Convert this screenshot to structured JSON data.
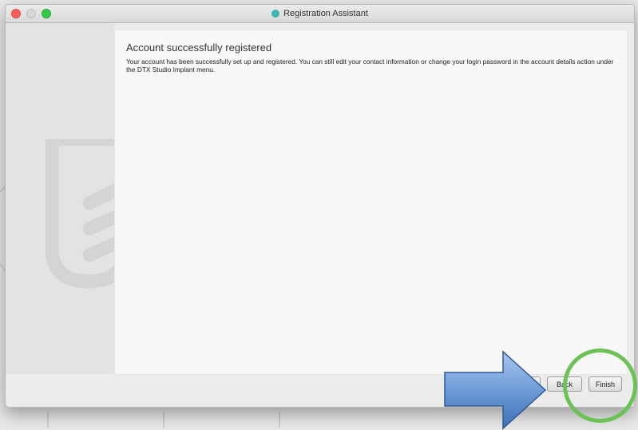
{
  "window": {
    "title": "Registration Assistant"
  },
  "content": {
    "heading": "Account successfully registered",
    "body": "Your account has been successfully set up and registered. You can still edit your contact information or change your login password in the account details action under the DTX Studio Implant menu."
  },
  "buttons": {
    "back_label": "Back",
    "finish_label": "Finish"
  },
  "colors": {
    "annotation_arrow": "#5b8fd1",
    "annotation_circle": "#6cc157",
    "close": "#fc5f57",
    "maximize": "#34c84a"
  },
  "icons": [
    "close-icon",
    "minimize-icon",
    "maximize-icon",
    "app-icon",
    "dtx-logo-icon",
    "arrow-annotation-icon",
    "circle-annotation-icon"
  ]
}
